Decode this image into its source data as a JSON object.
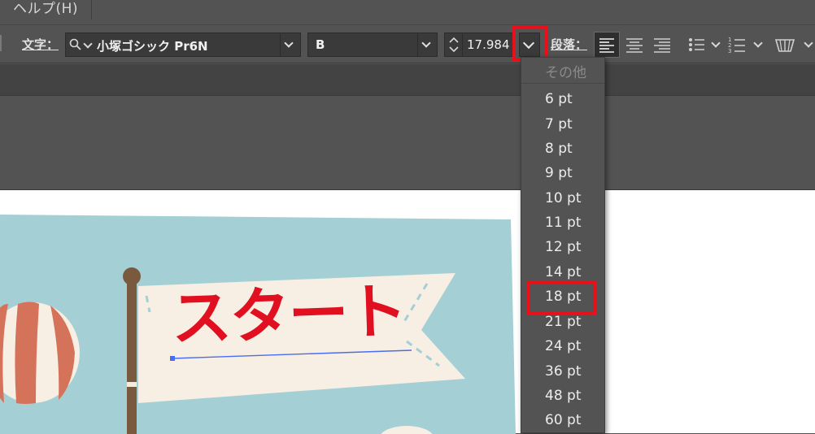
{
  "menubar": {
    "help_label": "ヘルプ(H)"
  },
  "toolbar": {
    "char_label": "文字：",
    "font_family": "小塚ゴシック Pr6N",
    "font_style": "B",
    "font_size": "17.984",
    "para_label": "段落："
  },
  "size_menu": {
    "header": "その他",
    "options": [
      "6 pt",
      "7 pt",
      "8 pt",
      "9 pt",
      "10 pt",
      "11 pt",
      "12 pt",
      "14 pt",
      "18 pt",
      "21 pt",
      "24 pt",
      "36 pt",
      "48 pt",
      "60 pt"
    ],
    "selected": "18 pt"
  },
  "artwork": {
    "flag_text": "スタート"
  },
  "colors": {
    "highlight": "#e8101a",
    "accent_text": "#e01020"
  }
}
